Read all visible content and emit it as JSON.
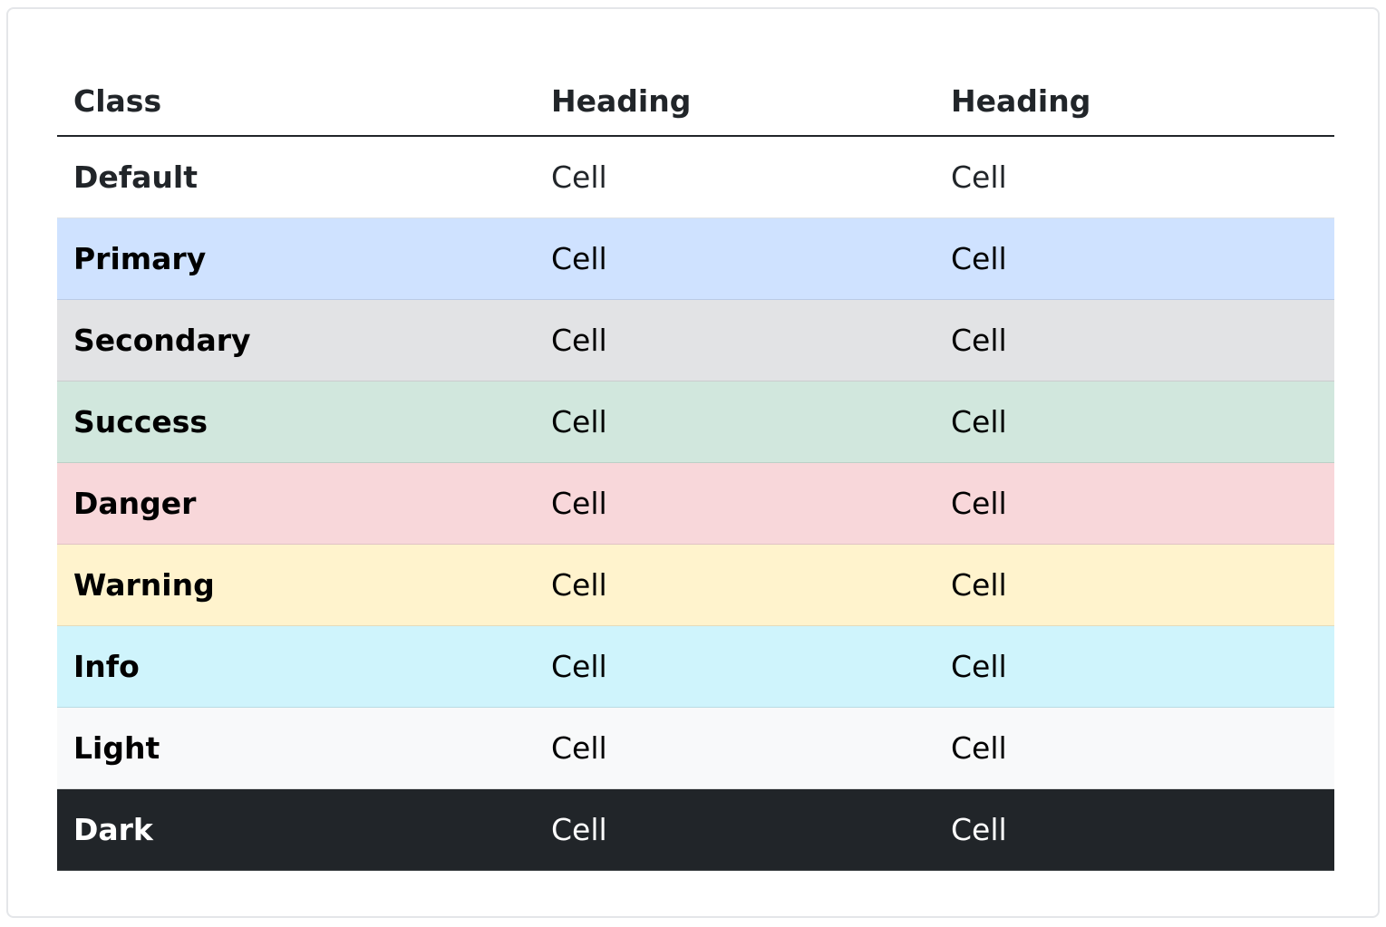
{
  "table": {
    "headers": [
      "Class",
      "Heading",
      "Heading"
    ],
    "rows": [
      {
        "label": "Default",
        "cells": [
          "Cell",
          "Cell"
        ],
        "bg": "#ffffff",
        "fg": "#212529"
      },
      {
        "label": "Primary",
        "cells": [
          "Cell",
          "Cell"
        ],
        "bg": "#cfe2ff",
        "fg": "#000000"
      },
      {
        "label": "Secondary",
        "cells": [
          "Cell",
          "Cell"
        ],
        "bg": "#e2e3e5",
        "fg": "#000000"
      },
      {
        "label": "Success",
        "cells": [
          "Cell",
          "Cell"
        ],
        "bg": "#d1e7dd",
        "fg": "#000000"
      },
      {
        "label": "Danger",
        "cells": [
          "Cell",
          "Cell"
        ],
        "bg": "#f8d7da",
        "fg": "#000000"
      },
      {
        "label": "Warning",
        "cells": [
          "Cell",
          "Cell"
        ],
        "bg": "#fff3cd",
        "fg": "#000000"
      },
      {
        "label": "Info",
        "cells": [
          "Cell",
          "Cell"
        ],
        "bg": "#cff4fc",
        "fg": "#000000"
      },
      {
        "label": "Light",
        "cells": [
          "Cell",
          "Cell"
        ],
        "bg": "#f8f9fa",
        "fg": "#000000"
      },
      {
        "label": "Dark",
        "cells": [
          "Cell",
          "Cell"
        ],
        "bg": "#212529",
        "fg": "#ffffff"
      }
    ]
  }
}
